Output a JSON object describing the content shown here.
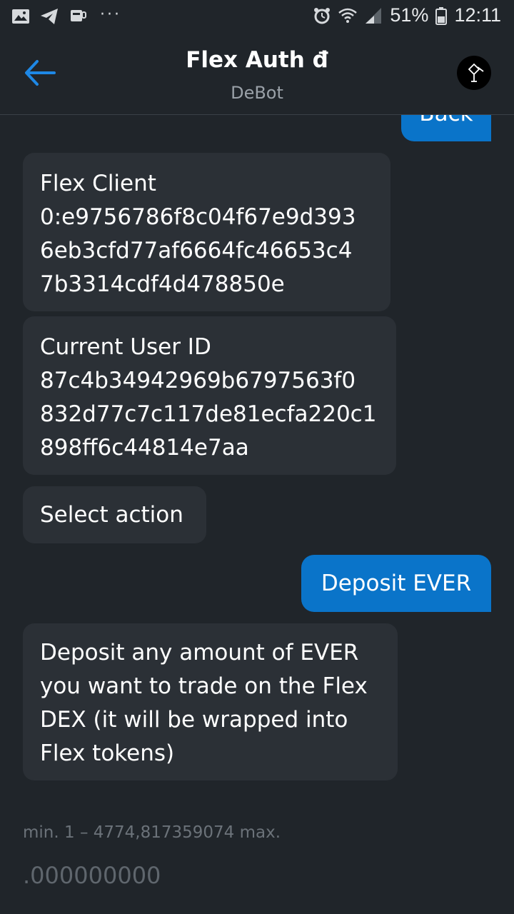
{
  "status_bar": {
    "battery_percent": "51%",
    "time": "12:11",
    "more_dots": "···"
  },
  "header": {
    "title": "Flex Auth đ",
    "subtitle": "DeBot"
  },
  "messages": [
    {
      "direction": "out",
      "text": "Back"
    },
    {
      "direction": "in",
      "text": "Flex Client 0:e9756786f8c04f67e9d3936eb3cfd77af6664fc46653c47b3314cdf4d478850e",
      "lines": [
        "Flex Client",
        "0:e9756786f8c04f67e9d393",
        "6eb3cfd77af6664fc46653c4",
        "7b3314cdf4d478850e"
      ]
    },
    {
      "direction": "in",
      "text": "Current User ID 87c4b34942969b6797563f0832d77c7c117de81ecfa220c1898ff6c44814e7aa",
      "lines": [
        "Current User ID",
        "87c4b34942969b6797563f0",
        "832d77c7c117de81ecfa220c1",
        "898ff6c44814e7aa"
      ]
    },
    {
      "direction": "in",
      "text": "Select action"
    },
    {
      "direction": "out",
      "text": "Deposit EVER"
    },
    {
      "direction": "in",
      "text": "Deposit any amount of EVER you want to trade on the Flex DEX (it will be wrapped into Flex tokens)",
      "lines": [
        "Deposit any amount of EVER",
        "you want to trade on the Flex",
        "DEX (it will be wrapped into",
        "Flex tokens)"
      ]
    }
  ],
  "amount": {
    "limits": "min. 1 – 4774,817359074 max.",
    "placeholder": ".000000000"
  },
  "colors": {
    "background": "#20252a",
    "incoming_bubble": "#2b3036",
    "outgoing_bubble": "#0a74c9",
    "accent": "#1e88e5"
  }
}
